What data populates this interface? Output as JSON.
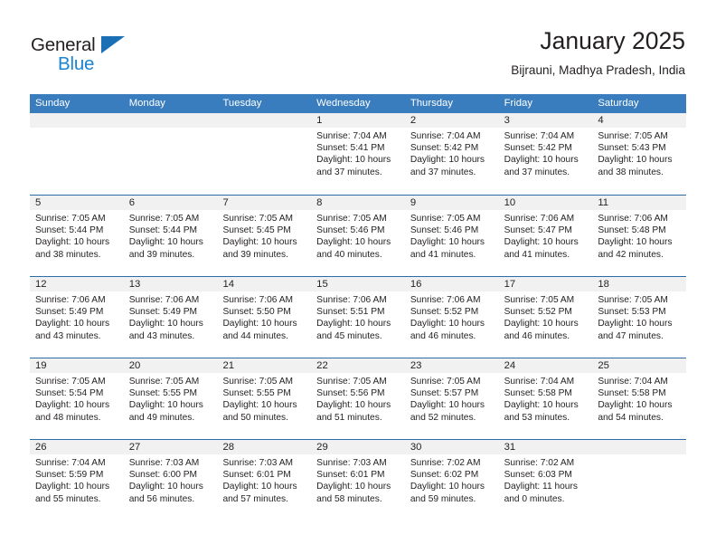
{
  "brand": {
    "word_one": "General",
    "word_two": "Blue",
    "triangle_color": "#1a6fb5",
    "blue_color": "#1b84d0"
  },
  "header": {
    "title": "January 2025",
    "subtitle": "Bijrauni, Madhya Pradesh, India"
  },
  "theme": {
    "header_bg": "#3a7dbf",
    "header_text": "#ffffff",
    "daynum_bg": "#f1f1f1",
    "week_rule": "#2c6ca8",
    "text": "#231f20"
  },
  "calendar": {
    "weekday_headers": [
      "Sunday",
      "Monday",
      "Tuesday",
      "Wednesday",
      "Thursday",
      "Friday",
      "Saturday"
    ],
    "weeks": [
      [
        {
          "day": "",
          "lines": []
        },
        {
          "day": "",
          "lines": []
        },
        {
          "day": "",
          "lines": []
        },
        {
          "day": "1",
          "lines": [
            "Sunrise: 7:04 AM",
            "Sunset: 5:41 PM",
            "Daylight: 10 hours",
            "and 37 minutes."
          ]
        },
        {
          "day": "2",
          "lines": [
            "Sunrise: 7:04 AM",
            "Sunset: 5:42 PM",
            "Daylight: 10 hours",
            "and 37 minutes."
          ]
        },
        {
          "day": "3",
          "lines": [
            "Sunrise: 7:04 AM",
            "Sunset: 5:42 PM",
            "Daylight: 10 hours",
            "and 37 minutes."
          ]
        },
        {
          "day": "4",
          "lines": [
            "Sunrise: 7:05 AM",
            "Sunset: 5:43 PM",
            "Daylight: 10 hours",
            "and 38 minutes."
          ]
        }
      ],
      [
        {
          "day": "5",
          "lines": [
            "Sunrise: 7:05 AM",
            "Sunset: 5:44 PM",
            "Daylight: 10 hours",
            "and 38 minutes."
          ]
        },
        {
          "day": "6",
          "lines": [
            "Sunrise: 7:05 AM",
            "Sunset: 5:44 PM",
            "Daylight: 10 hours",
            "and 39 minutes."
          ]
        },
        {
          "day": "7",
          "lines": [
            "Sunrise: 7:05 AM",
            "Sunset: 5:45 PM",
            "Daylight: 10 hours",
            "and 39 minutes."
          ]
        },
        {
          "day": "8",
          "lines": [
            "Sunrise: 7:05 AM",
            "Sunset: 5:46 PM",
            "Daylight: 10 hours",
            "and 40 minutes."
          ]
        },
        {
          "day": "9",
          "lines": [
            "Sunrise: 7:05 AM",
            "Sunset: 5:46 PM",
            "Daylight: 10 hours",
            "and 41 minutes."
          ]
        },
        {
          "day": "10",
          "lines": [
            "Sunrise: 7:06 AM",
            "Sunset: 5:47 PM",
            "Daylight: 10 hours",
            "and 41 minutes."
          ]
        },
        {
          "day": "11",
          "lines": [
            "Sunrise: 7:06 AM",
            "Sunset: 5:48 PM",
            "Daylight: 10 hours",
            "and 42 minutes."
          ]
        }
      ],
      [
        {
          "day": "12",
          "lines": [
            "Sunrise: 7:06 AM",
            "Sunset: 5:49 PM",
            "Daylight: 10 hours",
            "and 43 minutes."
          ]
        },
        {
          "day": "13",
          "lines": [
            "Sunrise: 7:06 AM",
            "Sunset: 5:49 PM",
            "Daylight: 10 hours",
            "and 43 minutes."
          ]
        },
        {
          "day": "14",
          "lines": [
            "Sunrise: 7:06 AM",
            "Sunset: 5:50 PM",
            "Daylight: 10 hours",
            "and 44 minutes."
          ]
        },
        {
          "day": "15",
          "lines": [
            "Sunrise: 7:06 AM",
            "Sunset: 5:51 PM",
            "Daylight: 10 hours",
            "and 45 minutes."
          ]
        },
        {
          "day": "16",
          "lines": [
            "Sunrise: 7:06 AM",
            "Sunset: 5:52 PM",
            "Daylight: 10 hours",
            "and 46 minutes."
          ]
        },
        {
          "day": "17",
          "lines": [
            "Sunrise: 7:05 AM",
            "Sunset: 5:52 PM",
            "Daylight: 10 hours",
            "and 46 minutes."
          ]
        },
        {
          "day": "18",
          "lines": [
            "Sunrise: 7:05 AM",
            "Sunset: 5:53 PM",
            "Daylight: 10 hours",
            "and 47 minutes."
          ]
        }
      ],
      [
        {
          "day": "19",
          "lines": [
            "Sunrise: 7:05 AM",
            "Sunset: 5:54 PM",
            "Daylight: 10 hours",
            "and 48 minutes."
          ]
        },
        {
          "day": "20",
          "lines": [
            "Sunrise: 7:05 AM",
            "Sunset: 5:55 PM",
            "Daylight: 10 hours",
            "and 49 minutes."
          ]
        },
        {
          "day": "21",
          "lines": [
            "Sunrise: 7:05 AM",
            "Sunset: 5:55 PM",
            "Daylight: 10 hours",
            "and 50 minutes."
          ]
        },
        {
          "day": "22",
          "lines": [
            "Sunrise: 7:05 AM",
            "Sunset: 5:56 PM",
            "Daylight: 10 hours",
            "and 51 minutes."
          ]
        },
        {
          "day": "23",
          "lines": [
            "Sunrise: 7:05 AM",
            "Sunset: 5:57 PM",
            "Daylight: 10 hours",
            "and 52 minutes."
          ]
        },
        {
          "day": "24",
          "lines": [
            "Sunrise: 7:04 AM",
            "Sunset: 5:58 PM",
            "Daylight: 10 hours",
            "and 53 minutes."
          ]
        },
        {
          "day": "25",
          "lines": [
            "Sunrise: 7:04 AM",
            "Sunset: 5:58 PM",
            "Daylight: 10 hours",
            "and 54 minutes."
          ]
        }
      ],
      [
        {
          "day": "26",
          "lines": [
            "Sunrise: 7:04 AM",
            "Sunset: 5:59 PM",
            "Daylight: 10 hours",
            "and 55 minutes."
          ]
        },
        {
          "day": "27",
          "lines": [
            "Sunrise: 7:03 AM",
            "Sunset: 6:00 PM",
            "Daylight: 10 hours",
            "and 56 minutes."
          ]
        },
        {
          "day": "28",
          "lines": [
            "Sunrise: 7:03 AM",
            "Sunset: 6:01 PM",
            "Daylight: 10 hours",
            "and 57 minutes."
          ]
        },
        {
          "day": "29",
          "lines": [
            "Sunrise: 7:03 AM",
            "Sunset: 6:01 PM",
            "Daylight: 10 hours",
            "and 58 minutes."
          ]
        },
        {
          "day": "30",
          "lines": [
            "Sunrise: 7:02 AM",
            "Sunset: 6:02 PM",
            "Daylight: 10 hours",
            "and 59 minutes."
          ]
        },
        {
          "day": "31",
          "lines": [
            "Sunrise: 7:02 AM",
            "Sunset: 6:03 PM",
            "Daylight: 11 hours",
            "and 0 minutes."
          ]
        },
        {
          "day": "",
          "lines": []
        }
      ]
    ]
  }
}
